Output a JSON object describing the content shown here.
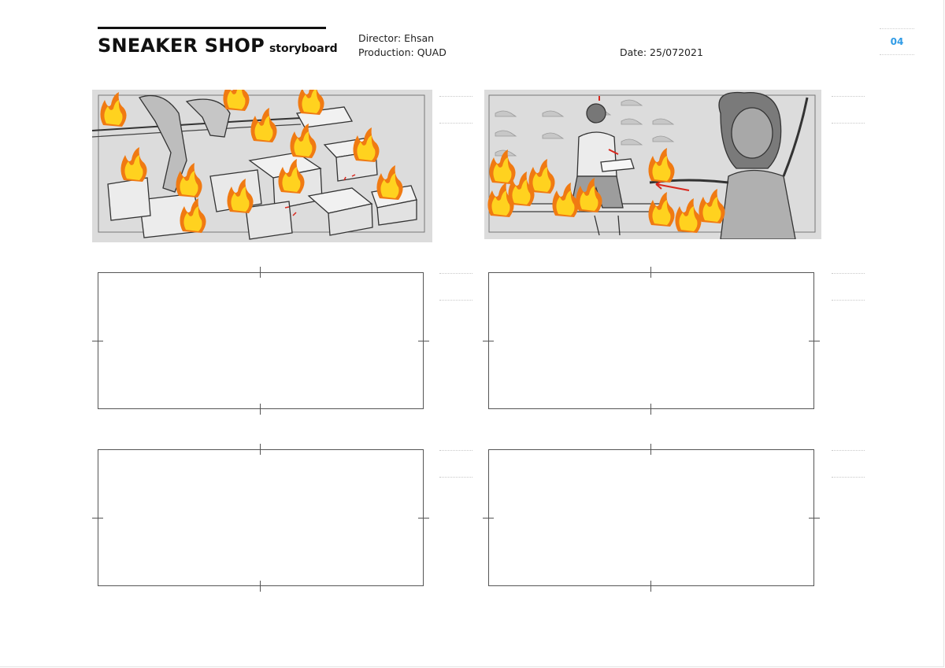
{
  "header": {
    "title": "SNEAKER SHOP",
    "subtitle": "storyboard",
    "director": "Director: Ehsan",
    "production": "Production: QUAD",
    "date": "Date: 25/072021",
    "page_number": "04"
  },
  "panels": [
    {
      "name": "panel-1",
      "content": "sketch",
      "scene": "shoe-boxes-on-fire"
    },
    {
      "name": "panel-2",
      "content": "sketch",
      "scene": "man-and-woman-in-shop-with-flames"
    },
    {
      "name": "panel-3",
      "content": "empty"
    },
    {
      "name": "panel-4",
      "content": "empty"
    },
    {
      "name": "panel-5",
      "content": "empty"
    },
    {
      "name": "panel-6",
      "content": "empty"
    }
  ],
  "colors": {
    "page_number": "#2f9be6",
    "flame_yellow": "#ffd21f",
    "flame_orange": "#f07a12",
    "arrow_red": "#d9261c",
    "sketch_gray": "#dcdcdc"
  }
}
